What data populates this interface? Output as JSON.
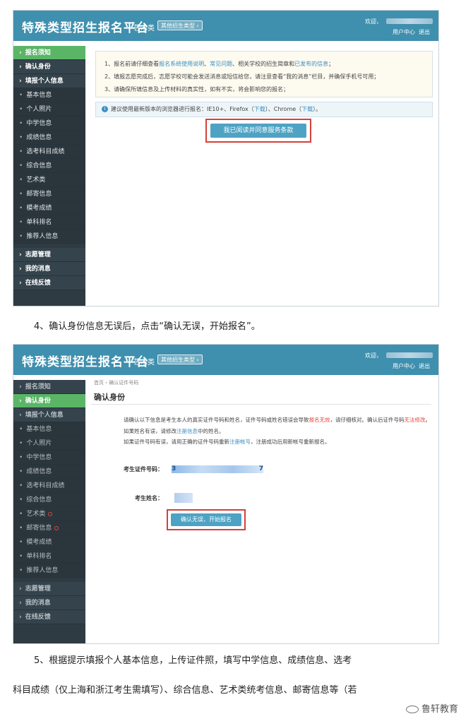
{
  "screen1": {
    "header": {
      "title": "特殊类型招生报名平台",
      "category": "艺术类",
      "other_types": "其他招生类型 ›",
      "welcome": "欢迎，",
      "user_center": "用户中心",
      "logout": "退出"
    },
    "sidebar": [
      {
        "label": "报名须知",
        "kind": "main",
        "active": true
      },
      {
        "label": "确认身份",
        "kind": "main"
      },
      {
        "label": "填报个人信息",
        "kind": "main"
      },
      {
        "label": "基本信息",
        "kind": "sub"
      },
      {
        "label": "个人照片",
        "kind": "sub"
      },
      {
        "label": "中学信息",
        "kind": "sub"
      },
      {
        "label": "成绩信息",
        "kind": "sub"
      },
      {
        "label": "选考科目成绩",
        "kind": "sub"
      },
      {
        "label": "综合信息",
        "kind": "sub"
      },
      {
        "label": "艺术类",
        "kind": "sub"
      },
      {
        "label": "邮寄信息",
        "kind": "sub"
      },
      {
        "label": "模考成绩",
        "kind": "sub"
      },
      {
        "label": "单科排名",
        "kind": "sub"
      },
      {
        "label": "推荐人信息",
        "kind": "sub"
      },
      {
        "label": "志愿管理",
        "kind": "main",
        "gap": true
      },
      {
        "label": "我的消息",
        "kind": "main"
      },
      {
        "label": "在线反馈",
        "kind": "main"
      }
    ],
    "notice": {
      "line1_a": "1、报名前请仔细查看",
      "line1_link1": "报名系统使用说明",
      "line1_sep": "、",
      "line1_link2": "常见问题",
      "line1_b": "、相关学校的招生简章和",
      "line1_link3": "已发布的信息",
      "line1_c": "；",
      "line2": "2、填报志愿完成后，志愿学校可能会发送消息或短信给您，请注意查看“我的消息”栏目，并确保手机号可用；",
      "line3": "3、请确保所填信息及上传材料的真实性，如有不实，将会影响您的报名；"
    },
    "browser_tip": {
      "text_a": "建议使用最新版本的浏览器进行报名：IE10+、Firefox（",
      "link1": "下载",
      "text_b": "）、Chrome（",
      "link2": "下载",
      "text_c": "）。"
    },
    "agree_button": "我已阅读并同意服务条款"
  },
  "caption4": "4、确认身份信息无误后，点击“确认无误，开始报名”。",
  "screen2": {
    "header": {
      "title": "特殊类型招生报名平台",
      "category": "艺术类",
      "other_types": "其他招生类型 ›",
      "welcome": "欢迎，",
      "user_center": "用户中心",
      "logout": "退出"
    },
    "sidebar": [
      {
        "label": "报名须知",
        "kind": "main"
      },
      {
        "label": "确认身份",
        "kind": "main",
        "active": true
      },
      {
        "label": "填报个人信息",
        "kind": "main"
      },
      {
        "label": "基本信息",
        "kind": "sub"
      },
      {
        "label": "个人照片",
        "kind": "sub"
      },
      {
        "label": "中学信息",
        "kind": "sub"
      },
      {
        "label": "成绩信息",
        "kind": "sub"
      },
      {
        "label": "选考科目成绩",
        "kind": "sub"
      },
      {
        "label": "综合信息",
        "kind": "sub"
      },
      {
        "label": "艺术类",
        "kind": "sub",
        "dot": true
      },
      {
        "label": "邮寄信息",
        "kind": "sub",
        "dot": true
      },
      {
        "label": "模考成绩",
        "kind": "sub"
      },
      {
        "label": "单科排名",
        "kind": "sub"
      },
      {
        "label": "推荐人信息",
        "kind": "sub"
      },
      {
        "label": "志愿管理",
        "kind": "main",
        "gap": true
      },
      {
        "label": "我的消息",
        "kind": "main"
      },
      {
        "label": "在线反馈",
        "kind": "main"
      }
    ],
    "breadcrumb": "首页 › 确认证件号码",
    "page_title": "确认身份",
    "para1_a": "请确认以下信息是考生本人的真实证件号码和姓名，证件号码或姓名错误会导致",
    "para1_red": "报名无效",
    "para1_b": "，请仔细核对。确认后证件号码",
    "para1_red2": "无法修改",
    "para1_c": "。",
    "para2_a": "如果姓名有误，请修改",
    "para2_link": "注册信息",
    "para2_b": "中的姓名。",
    "para3_a": "如果证件号码有误，请用正确的证件号码重新",
    "para3_link": "注册帐号",
    "para3_b": "，注册成功后用新帐号重新报名。",
    "id_label": "考生证件号码：",
    "id_first": "3",
    "id_last": "7",
    "name_label": "考生姓名：",
    "confirm_button": "确认无误，开始报名"
  },
  "caption5_line1": "5、根据提示填报个人基本信息，上传证件照，填写中学信息、成绩信息、选考",
  "caption5_line2": "科目成绩（仅上海和浙江考生需填写）、综合信息、艺术类统考信息、邮寄信息等（若",
  "watermark": "鲁轩教育"
}
